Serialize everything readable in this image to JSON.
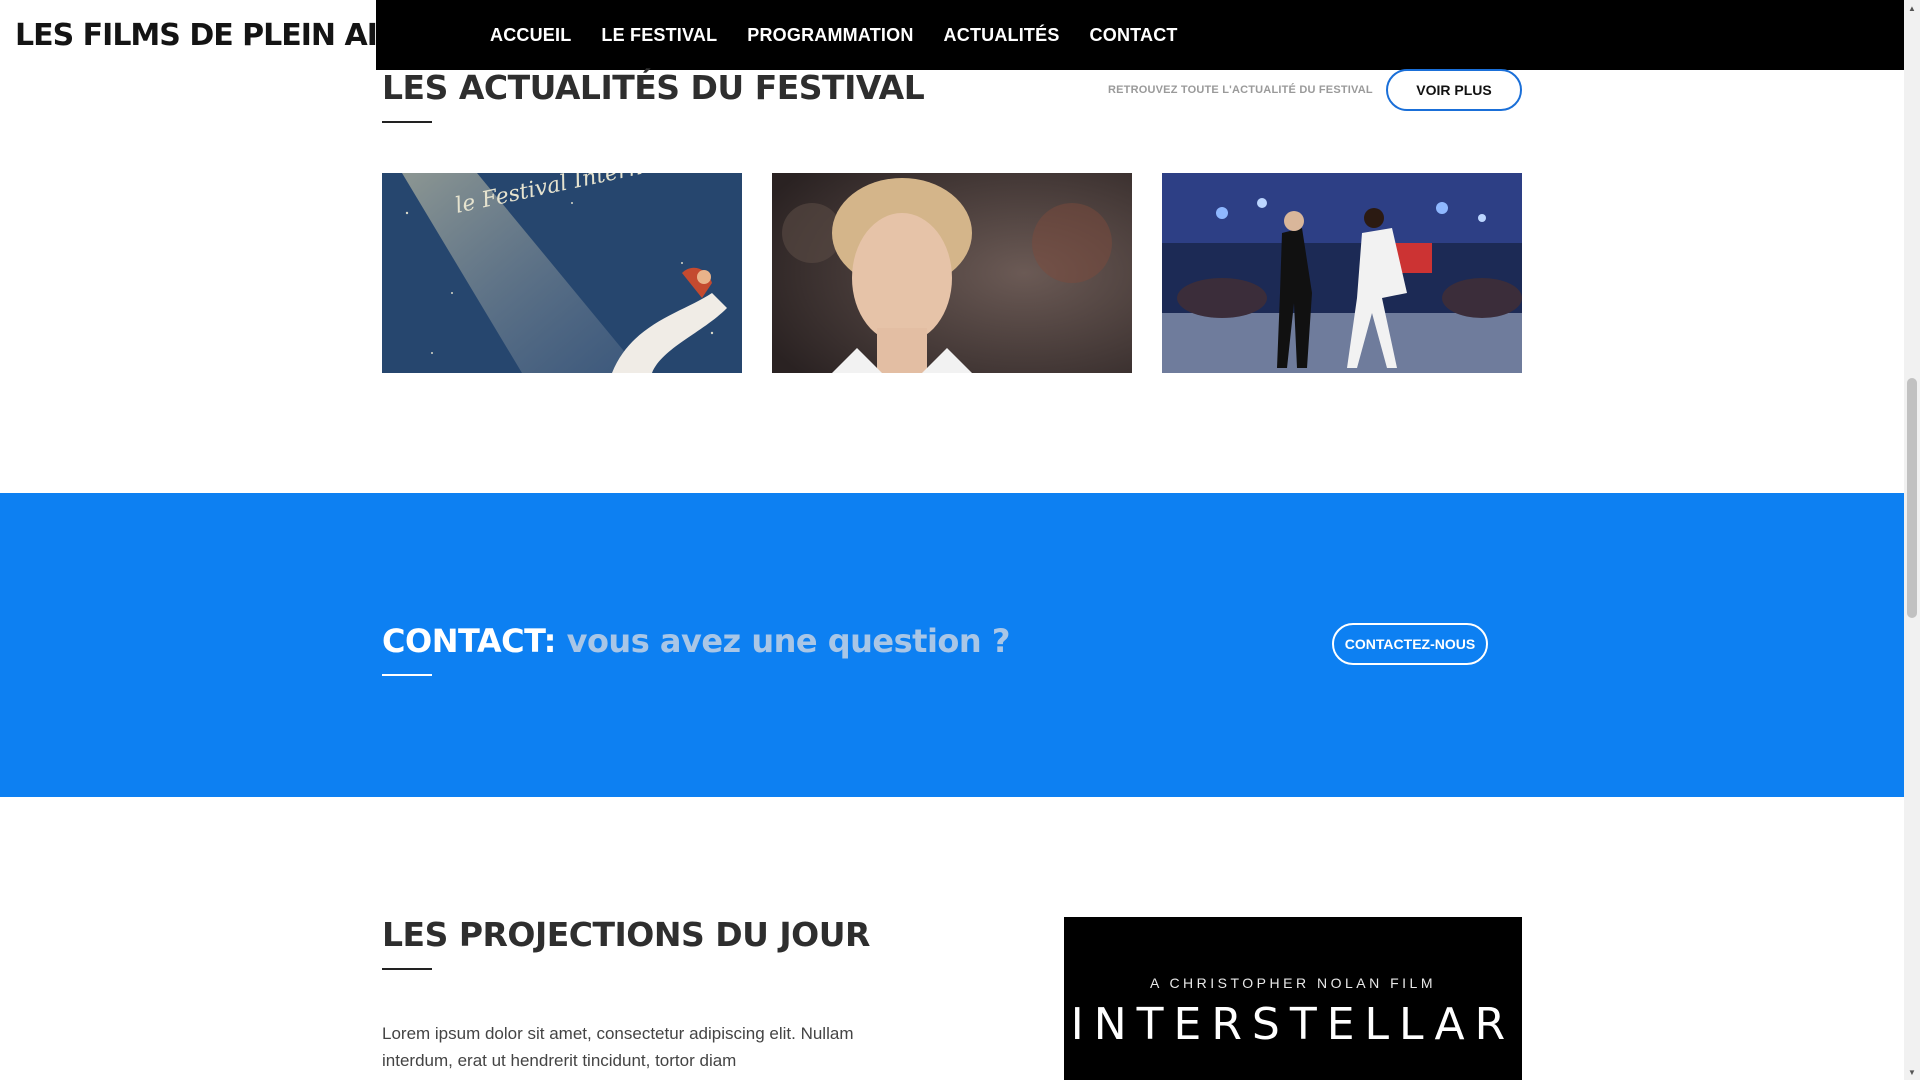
{
  "header": {
    "logo_text": "LES FILMS DE PLEIN AIR",
    "logo_dot": ".",
    "nav": [
      "ACCUEIL",
      "LE FESTIVAL",
      "PROGRAMMATION",
      "ACTUALITÉS",
      "CONTACT"
    ]
  },
  "news": {
    "title": "LES ACTUALITÉS DU FESTIVAL",
    "subtitle": "RETROUVEZ TOUTE L'ACTUALITÉ DU FESTIVAL",
    "more_button": "VOIR PLUS",
    "cards": [
      {
        "image": "festival-international-du-film-poster",
        "caption": "le Festival International du film"
      },
      {
        "image": "actress-portrait"
      },
      {
        "image": "dance-scene"
      }
    ]
  },
  "contact": {
    "title": "CONTACT:",
    "question": "vous avez une question ?",
    "button": "CONTACTEZ-NOUS"
  },
  "projections": {
    "title": "LES PROJECTIONS DU JOUR",
    "text": "Lorem ipsum dolor sit amet, consectetur adipiscing elit. Nullam interdum, erat ut hendrerit tincidunt, tortor diam",
    "poster": {
      "credit": "A CHRISTOPHER NOLAN FILM",
      "title": "INTERSTELLAR"
    }
  },
  "colors": {
    "accent": "#0d80f2",
    "nav_bg": "#000000",
    "button_border": "#1a6fd8"
  }
}
